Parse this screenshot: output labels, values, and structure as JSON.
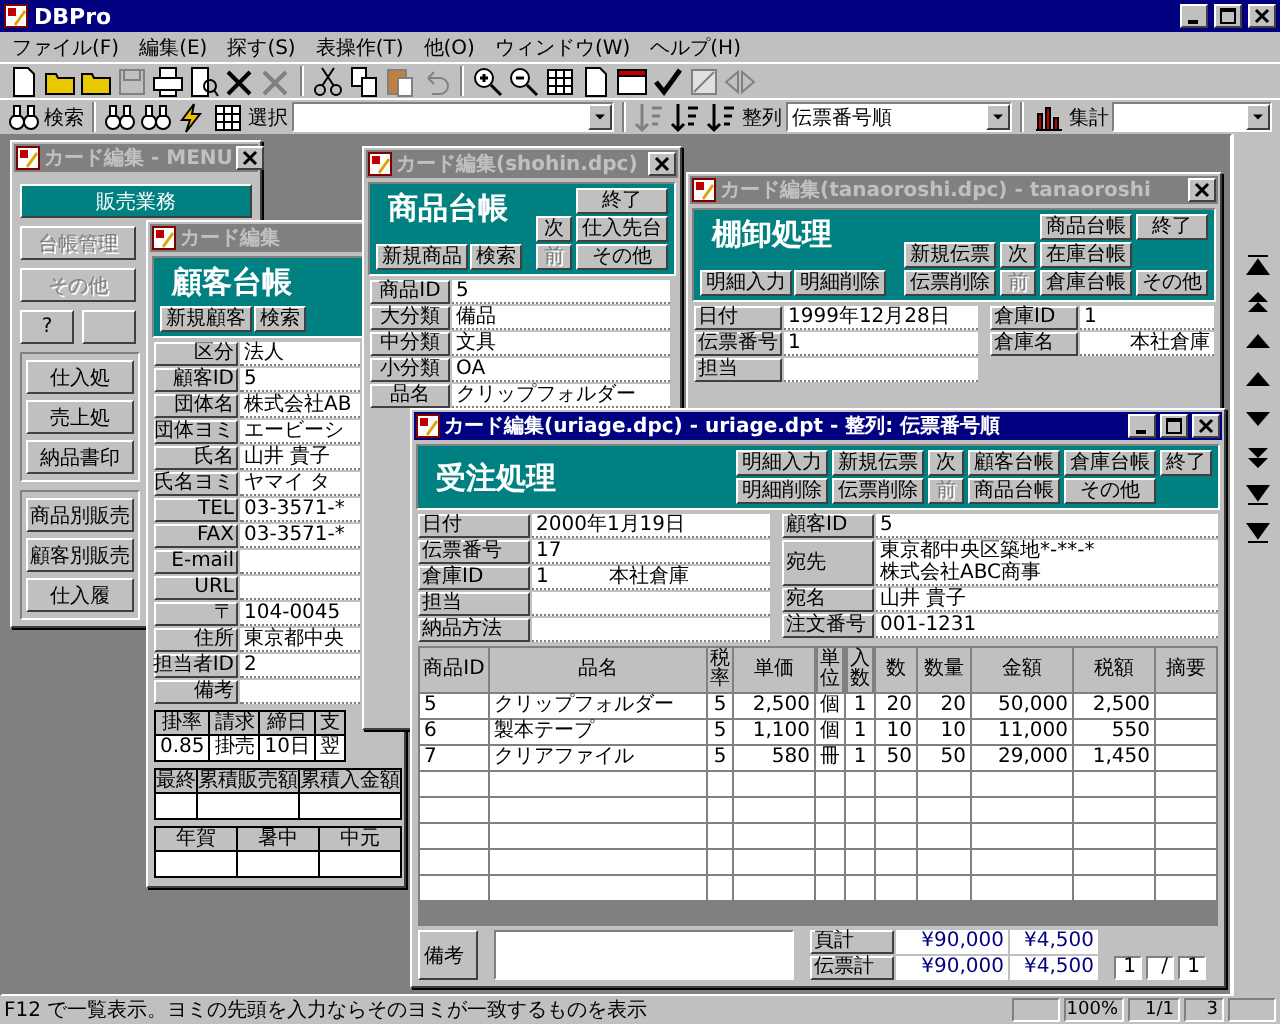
{
  "app": {
    "title": "DBPro"
  },
  "menu": [
    "ファイル(F)",
    "編集(E)",
    "探す(S)",
    "表操作(T)",
    "他(O)",
    "ウィンドウ(W)",
    "ヘルプ(H)"
  ],
  "toolbar": {
    "search_label": "検索",
    "select_label": "選択",
    "sort_label": "整列",
    "sort_value": "伝票番号順",
    "total_label": "集計"
  },
  "menu_window": {
    "title": "カード編集 - MENU",
    "active": false,
    "buttons": [
      {
        "label": "販売業務",
        "selected": true,
        "disabled": false
      },
      {
        "label": "台帳管理",
        "selected": false,
        "disabled": true
      },
      {
        "label": "その他",
        "selected": false,
        "disabled": true
      }
    ],
    "small_buttons": [
      "?"
    ],
    "groups": [
      [
        "仕入処",
        "売上処",
        "納品書印"
      ],
      [
        "商品別販売",
        "顧客別販売",
        "仕入履"
      ]
    ]
  },
  "customer_window": {
    "title": "カード編集",
    "active": false,
    "header": {
      "heading": "顧客台帳",
      "title_buttons": [
        {
          "label": "新規顧客",
          "disabled": false
        },
        {
          "label": "検索",
          "disabled": false
        }
      ]
    },
    "fields": [
      {
        "label": "区分",
        "value": "法人"
      },
      {
        "label": "顧客ID",
        "value": "5"
      },
      {
        "label": "団体名",
        "value": "株式会社AB"
      },
      {
        "label": "団体ヨミ",
        "value": "エービーシ"
      },
      {
        "label": "氏名",
        "value": "山井 貴子"
      },
      {
        "label": "氏名ヨミ",
        "value": "ヤマイ タ"
      },
      {
        "label": "TEL",
        "value": "03-3571-*"
      },
      {
        "label": "FAX",
        "value": "03-3571-*"
      },
      {
        "label": "E-mail"
      },
      {
        "label": "URL"
      },
      {
        "label": "〒",
        "value": "104-0045"
      },
      {
        "label": "住所",
        "value": "東京都中央"
      },
      {
        "label": "担当者ID",
        "value": "2"
      },
      {
        "label": "備考"
      }
    ],
    "terms": {
      "columns": [
        "掛率",
        "請求",
        "締日",
        "支"
      ],
      "values": [
        "0.85",
        "掛売",
        "10日",
        "翌"
      ]
    },
    "totals": {
      "columns": [
        "最終",
        "累積販売額",
        "累積入金額"
      ]
    },
    "seasonal": {
      "columns": [
        "年賀",
        "暑中",
        "中元"
      ]
    }
  },
  "product_window": {
    "title": "カード編集(shohin.dpc)",
    "active": false,
    "header": {
      "heading": "商品台帳",
      "title_buttons": [
        {
          "label": "新規商品",
          "disabled": false
        },
        {
          "label": "検索",
          "disabled": false
        }
      ],
      "columns": [
        {
          "kind": "bottom",
          "buttons": [
            {
              "label": "次",
              "disabled": false
            },
            {
              "label": "前",
              "disabled": true
            }
          ]
        },
        {
          "buttons": [
            {
              "label": "終了",
              "disabled": false
            },
            {
              "label": "仕入先台",
              "disabled": false
            },
            {
              "label": "その他",
              "disabled": false
            }
          ]
        }
      ]
    },
    "fields": [
      {
        "label": "商品ID",
        "value": "5"
      },
      {
        "label": "大分類",
        "value": "備品"
      },
      {
        "label": "中分類",
        "value": "文具"
      },
      {
        "label": "小分類",
        "value": "OA"
      },
      {
        "label": "品名",
        "value": "クリップフォルダー"
      }
    ]
  },
  "stock_window": {
    "title": "カード編集(tanaoroshi.dpc) - tanaoroshi",
    "active": false,
    "header": {
      "heading": "棚卸処理",
      "title_buttons": [
        {
          "label": "明細入力",
          "disabled": false
        },
        {
          "label": "明細削除",
          "disabled": false
        }
      ],
      "columns": [
        {
          "kind": "bottom",
          "buttons": [
            {
              "label": "新規伝票",
              "disabled": false
            },
            {
              "label": "伝票削除",
              "disabled": false
            }
          ]
        },
        {
          "kind": "bottom",
          "buttons": [
            {
              "label": "次",
              "disabled": false
            },
            {
              "label": "前",
              "disabled": true
            }
          ]
        },
        {
          "buttons": [
            {
              "label": "商品台帳",
              "disabled": false
            },
            {
              "label": "在庫台帳",
              "disabled": false
            },
            {
              "label": "倉庫台帳",
              "disabled": false
            }
          ]
        },
        {
          "kind": "spread",
          "buttons": [
            {
              "label": "終了",
              "disabled": false
            },
            {
              "label": "その他",
              "disabled": false
            }
          ]
        }
      ]
    },
    "fields_left": [
      {
        "label": "日付",
        "value": "1999年12月28日"
      },
      {
        "label": "伝票番号",
        "value": "1"
      },
      {
        "label": "担当"
      }
    ],
    "fields_right": [
      {
        "label": "倉庫ID",
        "value": "1"
      },
      {
        "label": "倉庫名",
        "value": "本社倉庫",
        "right_aligned": true
      }
    ]
  },
  "order_window": {
    "title": "カード編集(uriage.dpc) - uriage.dpt - 整列: 伝票番号順",
    "active": true,
    "header": {
      "heading": "受注処理",
      "columns": [
        {
          "buttons": [
            {
              "label": "明細入力",
              "disabled": false
            },
            {
              "label": "明細削除",
              "disabled": false
            }
          ]
        },
        {
          "buttons": [
            {
              "label": "新規伝票",
              "disabled": false
            },
            {
              "label": "伝票削除",
              "disabled": false
            }
          ]
        },
        {
          "buttons": [
            {
              "label": "次",
              "disabled": false
            },
            {
              "label": "前",
              "disabled": true
            }
          ]
        },
        {
          "buttons": [
            {
              "label": "顧客台帳",
              "disabled": false
            },
            {
              "label": "商品台帳",
              "disabled": false
            }
          ]
        },
        {
          "buttons": [
            {
              "label": "倉庫台帳",
              "disabled": false
            },
            {
              "label": "その他",
              "disabled": false
            }
          ]
        },
        {
          "buttons": [
            {
              "label": "終了",
              "disabled": false
            }
          ]
        }
      ]
    },
    "fields_left": [
      {
        "label": "日付",
        "value": "2000年1月19日"
      },
      {
        "label": "伝票番号",
        "value": "17"
      },
      {
        "label": "倉庫ID",
        "value": "1",
        "note": "本社倉庫"
      },
      {
        "label": "担当"
      },
      {
        "label": "納品方法"
      }
    ],
    "fields_right": [
      {
        "label": "顧客ID",
        "value": "5"
      },
      {
        "label": "宛先",
        "value": "東京都中央区築地*-**-*\n株式会社ABC商事"
      },
      {
        "label": "宛名",
        "value": "山井 貴子"
      },
      {
        "label": "注文番号",
        "value": "001-1231"
      }
    ],
    "table": {
      "columns": [
        {
          "label": "商品ID",
          "kind": "text"
        },
        {
          "label": "品名",
          "kind": "text"
        },
        {
          "label": "税率",
          "kind": "narrow"
        },
        {
          "label": "単価",
          "kind": "number"
        },
        {
          "label": "単位",
          "kind": "narrow"
        },
        {
          "label": "入数",
          "kind": "narrow"
        },
        {
          "label": "数",
          "kind": "number"
        },
        {
          "label": "数量",
          "kind": "number"
        },
        {
          "label": "金額",
          "kind": "number"
        },
        {
          "label": "税額",
          "kind": "number"
        },
        {
          "label": "摘要",
          "kind": "text"
        }
      ],
      "rows": [
        [
          "5",
          "クリップフォルダー",
          "5",
          "2,500",
          "個",
          "1",
          "20",
          "20",
          "50,000",
          "2,500"
        ],
        [
          "6",
          "製本テープ",
          "5",
          "1,100",
          "個",
          "1",
          "10",
          "10",
          "11,000",
          "550"
        ],
        [
          "7",
          "クリアファイル",
          "5",
          "580",
          "冊",
          "1",
          "50",
          "50",
          "29,000",
          "1,450"
        ]
      ]
    },
    "footer": {
      "remarks_label": "備考",
      "summary": [
        {
          "label": "頁計",
          "amount": "¥90,000",
          "tax": "¥4,500"
        },
        {
          "label": "伝票計",
          "amount": "¥90,000",
          "tax": "¥4,500"
        }
      ],
      "pager": [
        "1",
        "/",
        "1"
      ]
    }
  },
  "status_bar": {
    "message": "F12 で一覧表示。ヨミの先頭を入力ならそのヨミが一致するものを表示",
    "zoom": "100%",
    "page": "1/1",
    "count": "3"
  }
}
